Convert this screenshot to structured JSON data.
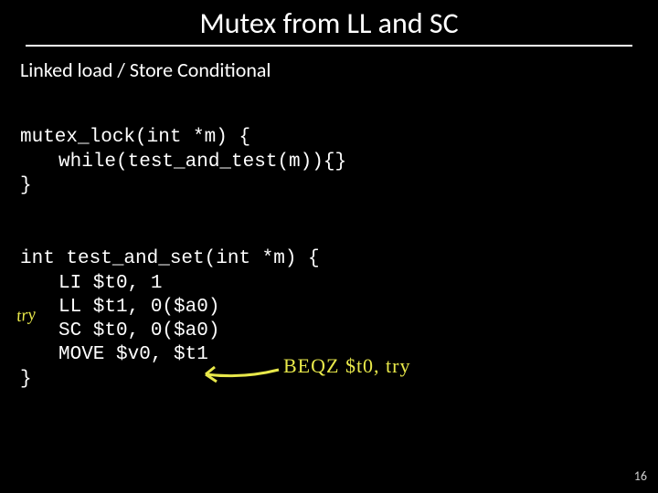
{
  "title": "Mutex from LL and SC",
  "subtitle": "Linked load / Store Conditional",
  "code1": {
    "line1": "mutex_lock(int *m) {",
    "line2": "while(test_and_test(m)){}",
    "line3": "}"
  },
  "code2": {
    "line1": "int test_and_set(int *m) {",
    "line2": "LI $t0, 1",
    "line3": "LL $t1, 0($a0)",
    "line4": "SC $t0, 0($a0)",
    "line5": "MOVE $v0, $t1",
    "line6": "}"
  },
  "annotations": {
    "try": "try",
    "beqz": "BEQZ $t0, try"
  },
  "page_number": "16"
}
